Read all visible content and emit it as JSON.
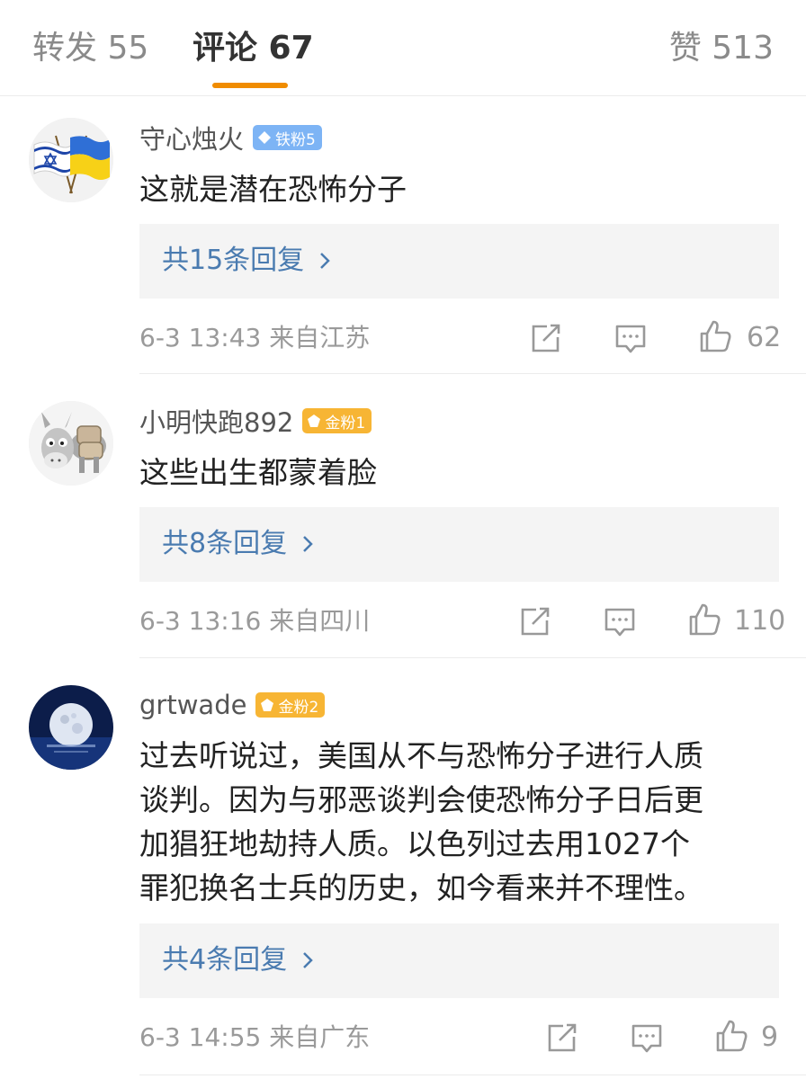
{
  "tabs": {
    "repost": "转发 55",
    "comments": "评论 67",
    "likes": "赞 513"
  },
  "comments": [
    {
      "username": "守心烛火",
      "badge": "铁粉5",
      "badge_type": "iron",
      "avatar": "israel-ukraine-flags-avatar",
      "content": "这就是潜在恐怖分子",
      "replies": "共15条回复",
      "time": "6-3 13:43",
      "location": "来自江苏",
      "likes": "62"
    },
    {
      "username": "小明快跑892",
      "badge": "金粉1",
      "badge_type": "gold",
      "avatar": "donkey-avatar",
      "content": "这些出生都蒙着脸",
      "replies": "共8条回复",
      "time": "6-3 13:16",
      "location": "来自四川",
      "likes": "110"
    },
    {
      "username": "grtwade",
      "badge": "金粉2",
      "badge_type": "gold",
      "avatar": "moon-avatar",
      "content_lines": [
        "过去听说过，美国从不与恐怖分子进行人质",
        "谈判。因为与邪恶谈判会使恐怖分子日后更",
        "加猖狂地劫持人质。以色列过去用1027个",
        "罪犯换名士兵的历史，如今看来并不理性。"
      ],
      "replies": "共4条回复",
      "time": "6-3 14:55",
      "location": "来自广东",
      "likes": "9"
    }
  ],
  "colors": {
    "accent": "#f08c00",
    "link": "#4a7bb0",
    "iron_badge": "#7db4f5",
    "gold_badge": "#f7b534"
  }
}
